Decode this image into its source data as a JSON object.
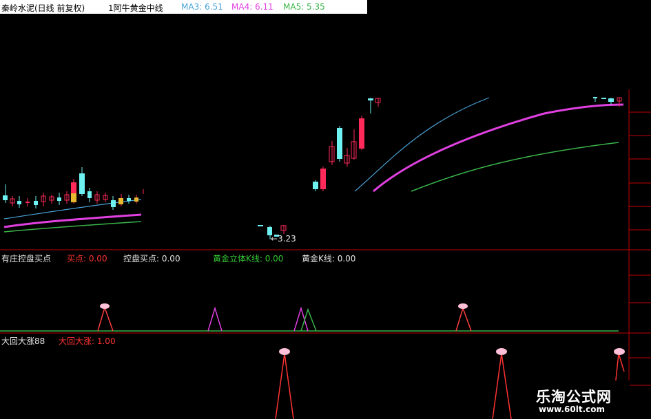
{
  "colors": {
    "ma3": "#4aa3d8",
    "ma4": "#e040e0",
    "ma5": "#3ab54a",
    "up": "#ff2a5a",
    "down": "#6ef1f1",
    "text_red": "#ff3333",
    "text_green": "#33cc33",
    "text_white": "#e6e6e6",
    "panel_border": "#c00000"
  },
  "main_panel": {
    "title": "秦岭水泥(日线 前复权)",
    "indicator": "1阿牛黄金中线",
    "ma3_label": "MA3: 6.51",
    "ma4_label": "MA4: 6.11",
    "ma5_label": "MA5: 5.35",
    "low_price_label": "←3.23"
  },
  "indicator_panel_1": {
    "name": "有庄控盘买点",
    "fields": [
      {
        "label": "买点: 0.00"
      },
      {
        "label": "控盘买点: 0.00"
      },
      {
        "label": "黄金立体K线: 0.00"
      },
      {
        "label": "黄金K线: 0.00"
      }
    ]
  },
  "indicator_panel_2": {
    "name": "大回大涨88",
    "fields": [
      {
        "label": "大回大涨: 1.00"
      }
    ]
  },
  "watermark": {
    "site_name": "乐淘公式网",
    "url": "www.60lt.com"
  }
}
